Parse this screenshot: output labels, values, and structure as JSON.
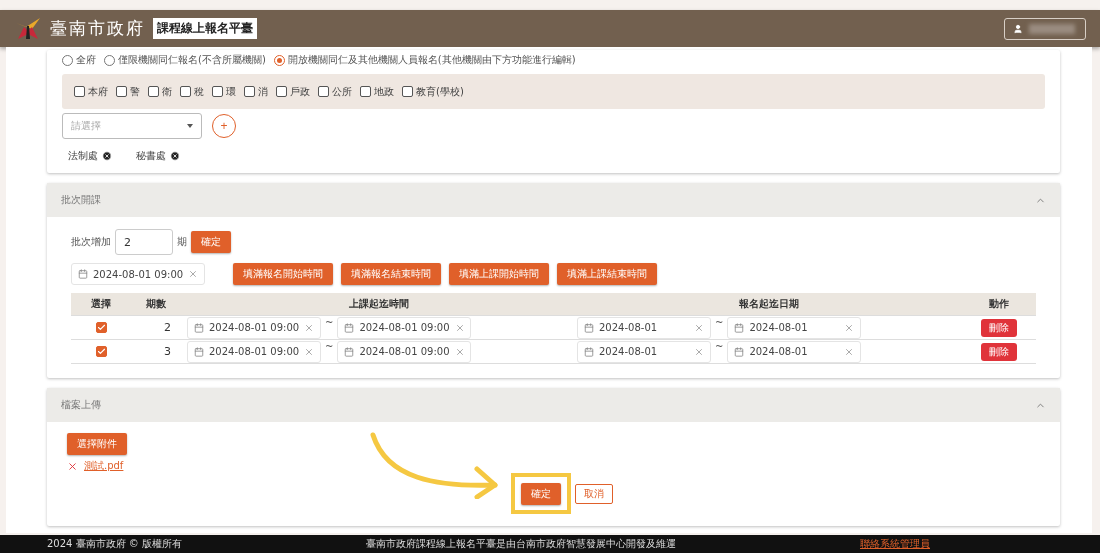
{
  "header": {
    "brand": "臺南市政府",
    "title": "課程線上報名平臺"
  },
  "scope_options": [
    {
      "label": "全府",
      "selected": false
    },
    {
      "label": "僅限機關同仁報名(不含所屬機關)",
      "selected": false
    },
    {
      "label": "開放機關同仁及其他機關人員報名(其他機關由下方功能進行編輯)",
      "selected": true
    }
  ],
  "org_filters": [
    {
      "label": "本府",
      "checked": false
    },
    {
      "label": "警",
      "checked": false
    },
    {
      "label": "衛",
      "checked": false
    },
    {
      "label": "稅",
      "checked": false
    },
    {
      "label": "環",
      "checked": false
    },
    {
      "label": "消",
      "checked": false
    },
    {
      "label": "戶政",
      "checked": false
    },
    {
      "label": "公所",
      "checked": false
    },
    {
      "label": "地政",
      "checked": false
    },
    {
      "label": "教育(學校)",
      "checked": false
    }
  ],
  "org_select": {
    "placeholder": "請選擇",
    "add": "+"
  },
  "selected_orgs": [
    "法制處",
    "秘書處"
  ],
  "batch_section": {
    "title": "批次開課",
    "expanded": true,
    "add_label": "批次增加",
    "add_value": "2",
    "unit": "期",
    "confirm": "確定",
    "default_time": "2024-08-01 09:00",
    "fill_buttons": [
      "填滿報名開始時間",
      "填滿報名結束時間",
      "填滿上課開始時間",
      "填滿上課結束時間"
    ],
    "columns": [
      "選擇",
      "期數",
      "上課起迄時間",
      "報名起迄日期",
      "動作"
    ],
    "rows": [
      {
        "checked": true,
        "period": "2",
        "class_start": "2024-08-01 09:00",
        "class_sep": "~",
        "class_end": "2024-08-01 09:00",
        "signup_start": "2024-08-01",
        "signup_sep": "~",
        "signup_end": "2024-08-01",
        "action": "刪除"
      },
      {
        "checked": true,
        "period": "3",
        "class_start": "2024-08-01 09:00",
        "class_sep": "~",
        "class_end": "2024-08-01 09:00",
        "signup_start": "2024-08-01",
        "signup_sep": "~",
        "signup_end": "2024-08-01",
        "action": "刪除"
      }
    ]
  },
  "upload_section": {
    "title": "檔案上傳",
    "expanded": true,
    "choose": "選擇附件",
    "files": [
      "測試.pdf"
    ]
  },
  "actions": {
    "confirm": "確定",
    "cancel": "取消"
  },
  "footer": {
    "copyright": "2024 臺南市政府 © 版權所有",
    "credit": "臺南市政府課程線上報名平臺是由台南市政府智慧發展中心開發及維運",
    "contact": "聯絡系統管理員"
  }
}
